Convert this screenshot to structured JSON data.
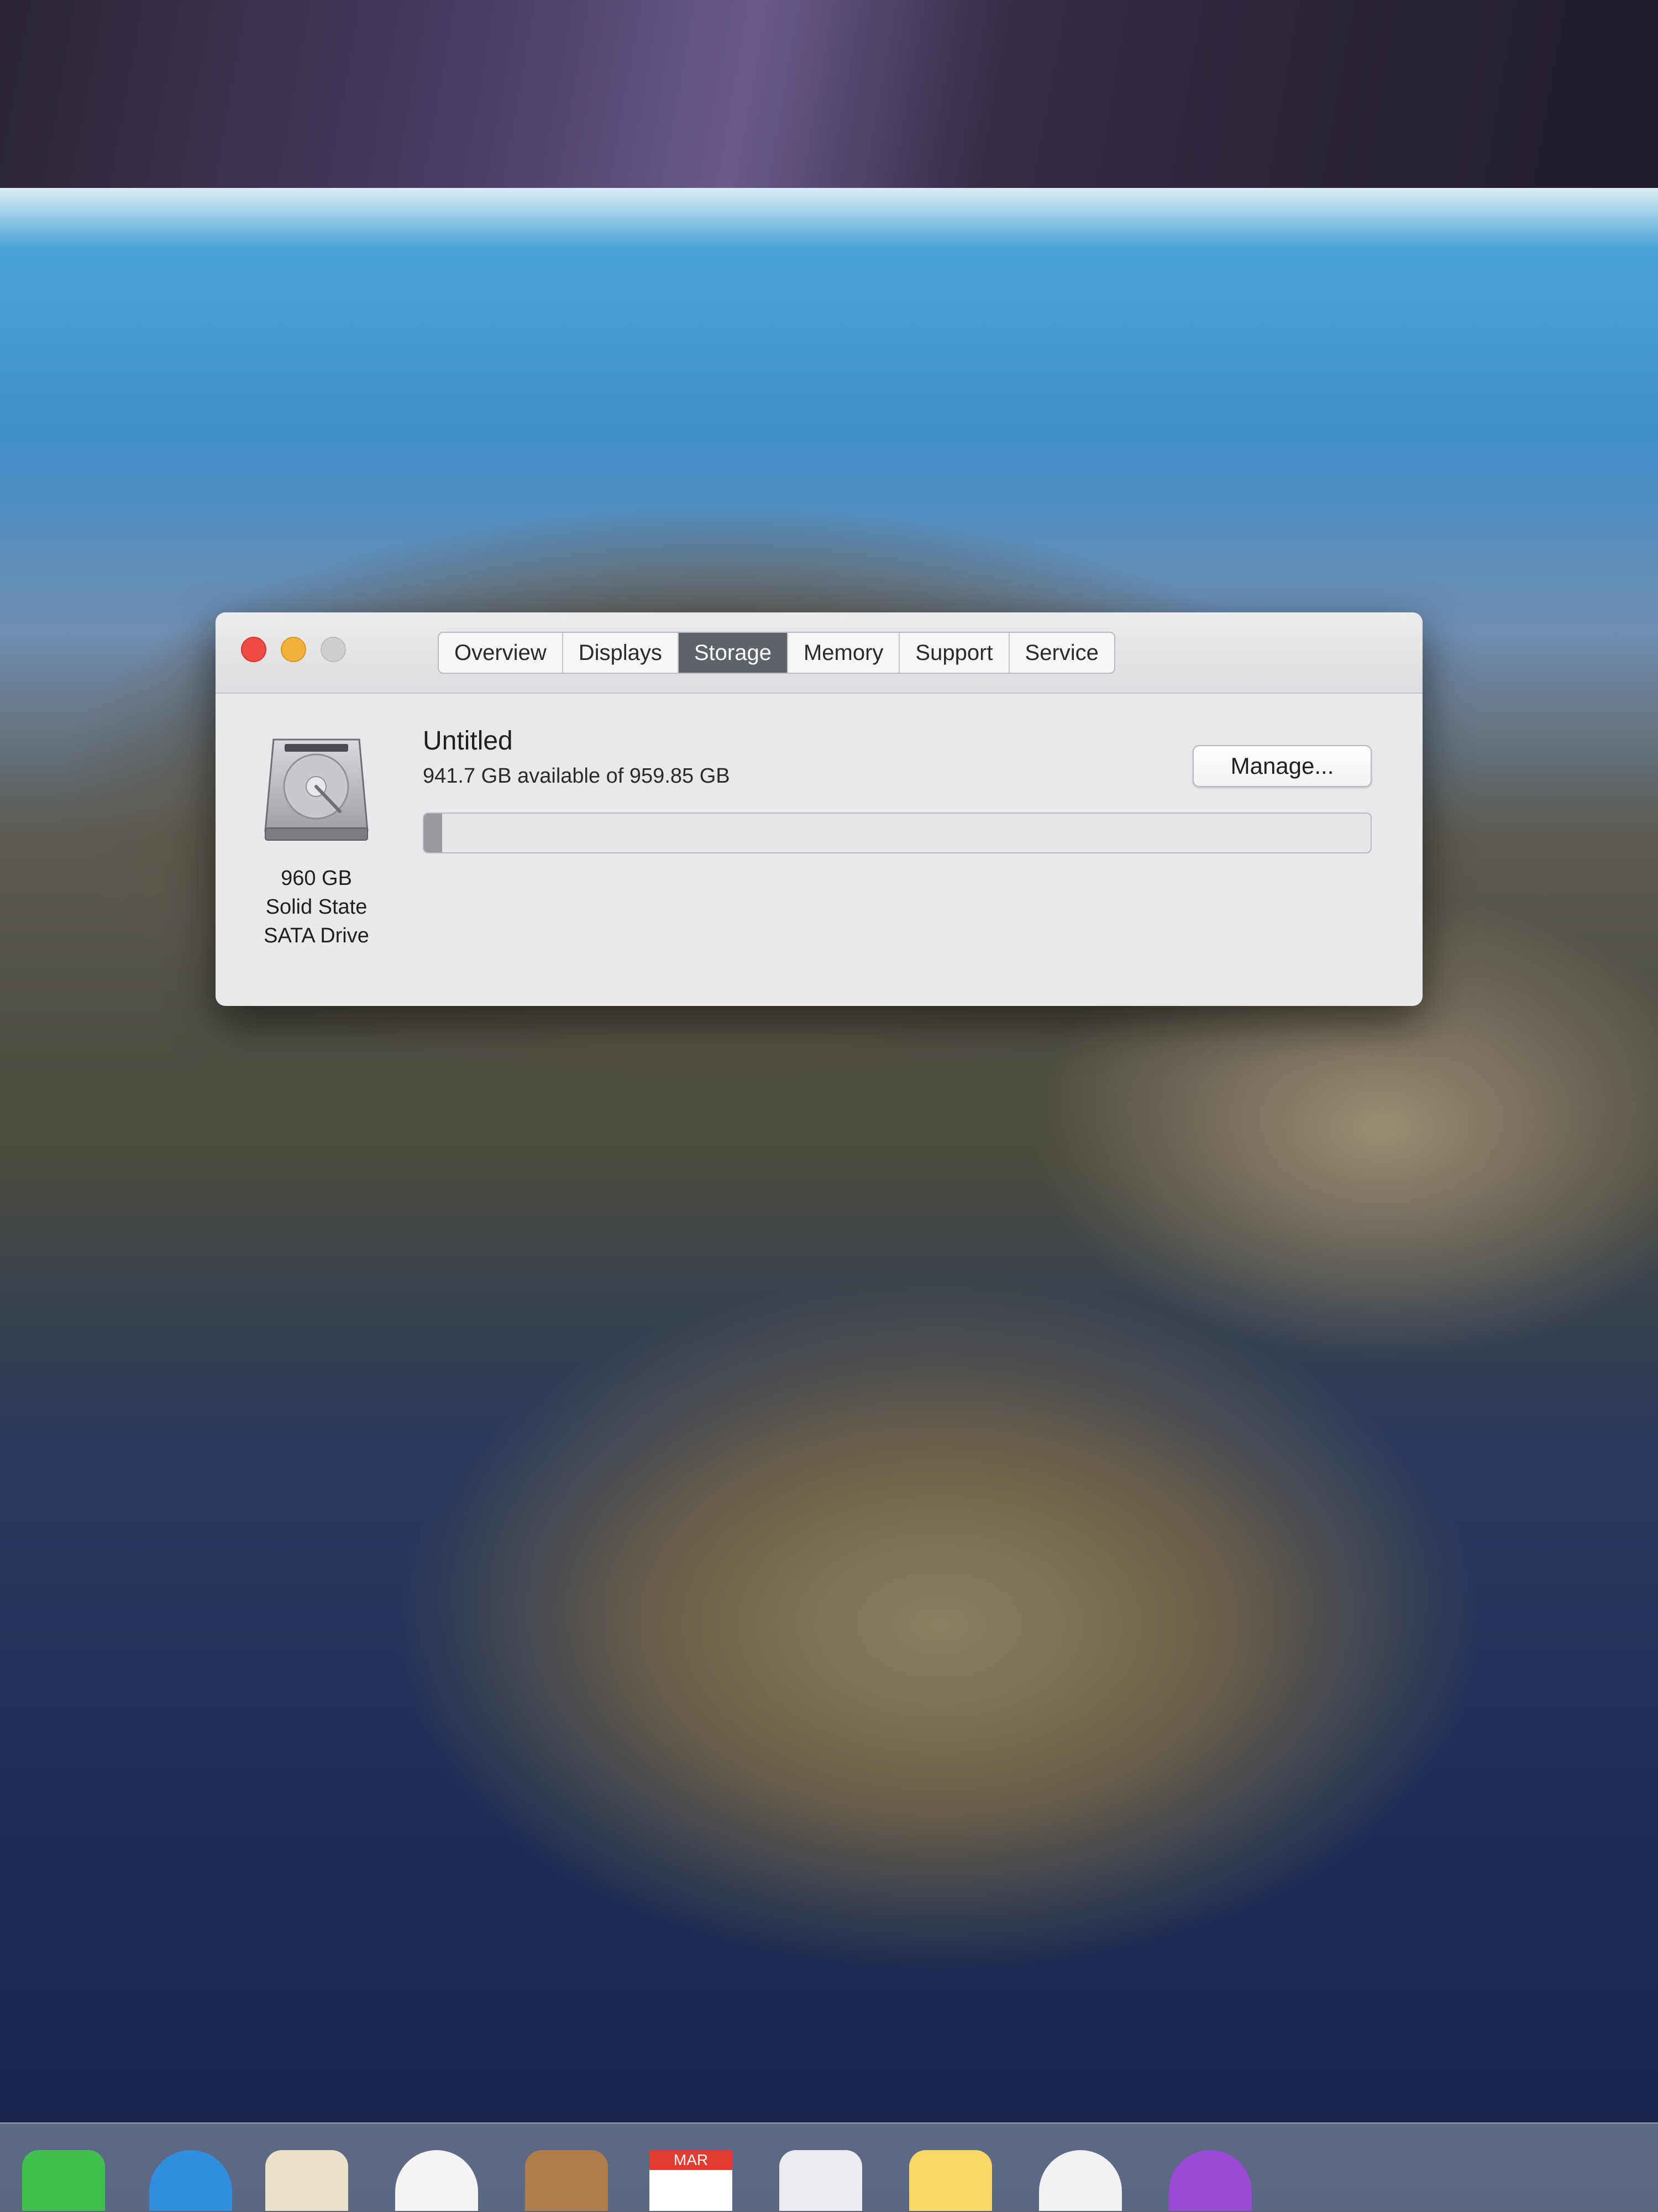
{
  "window": {
    "tabs": [
      {
        "label": "Overview",
        "active": false
      },
      {
        "label": "Displays",
        "active": false
      },
      {
        "label": "Storage",
        "active": true
      },
      {
        "label": "Memory",
        "active": false
      },
      {
        "label": "Support",
        "active": false
      },
      {
        "label": "Service",
        "active": false
      }
    ]
  },
  "storage": {
    "drive_icon": "hard-drive-icon",
    "drive_caption": [
      "960 GB",
      "Solid State",
      "SATA Drive"
    ],
    "volume_name": "Untitled",
    "available_text": "941.7 GB available of 959.85 GB",
    "manage_label": "Manage...",
    "used_fraction": 0.019
  },
  "dock": {
    "icons": [
      "facetime-icon",
      "safari-icon",
      "maps-icon",
      "photos-icon",
      "contacts-icon",
      "calendar-icon",
      "mail-icon",
      "notes-icon",
      "music-icon",
      "podcasts-icon"
    ],
    "calendar_month": "MAR"
  },
  "colors": {
    "close": "#ee4c43",
    "minimize": "#f1b13a",
    "zoom_disabled": "#cfcfd1",
    "active_tab": "#5f6268"
  }
}
